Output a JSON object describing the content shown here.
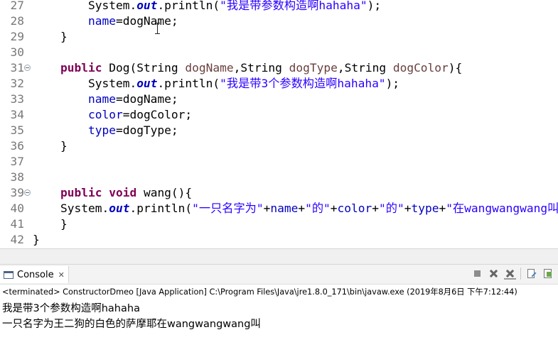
{
  "editor": {
    "lines": [
      {
        "num": "27",
        "fold": false,
        "tokens": [
          {
            "t": "        System.",
            "c": ""
          },
          {
            "t": "out",
            "c": "static"
          },
          {
            "t": ".println(",
            "c": ""
          },
          {
            "t": "\"我是带参数构造啊hahaha\"",
            "c": "str"
          },
          {
            "t": ");",
            "c": ""
          }
        ]
      },
      {
        "num": "28",
        "fold": false,
        "tokens": [
          {
            "t": "        ",
            "c": ""
          },
          {
            "t": "name",
            "c": "field"
          },
          {
            "t": "=dogName;",
            "c": ""
          }
        ]
      },
      {
        "num": "29",
        "fold": false,
        "tokens": [
          {
            "t": "    }",
            "c": ""
          }
        ]
      },
      {
        "num": "30",
        "fold": false,
        "tokens": []
      },
      {
        "num": "31",
        "fold": true,
        "tokens": [
          {
            "t": "    ",
            "c": ""
          },
          {
            "t": "public",
            "c": "kw"
          },
          {
            "t": " Dog(String ",
            "c": ""
          },
          {
            "t": "dogName",
            "c": "param"
          },
          {
            "t": ",String ",
            "c": ""
          },
          {
            "t": "dogType",
            "c": "param"
          },
          {
            "t": ",String ",
            "c": ""
          },
          {
            "t": "dogColor",
            "c": "param"
          },
          {
            "t": "){",
            "c": ""
          }
        ]
      },
      {
        "num": "32",
        "fold": false,
        "tokens": [
          {
            "t": "        System.",
            "c": ""
          },
          {
            "t": "out",
            "c": "static"
          },
          {
            "t": ".println(",
            "c": ""
          },
          {
            "t": "\"我是带3个参数构造啊hahaha\"",
            "c": "str"
          },
          {
            "t": ");",
            "c": ""
          }
        ]
      },
      {
        "num": "33",
        "fold": false,
        "tokens": [
          {
            "t": "        ",
            "c": ""
          },
          {
            "t": "name",
            "c": "field"
          },
          {
            "t": "=dogName;",
            "c": ""
          }
        ]
      },
      {
        "num": "34",
        "fold": false,
        "tokens": [
          {
            "t": "        ",
            "c": ""
          },
          {
            "t": "color",
            "c": "field"
          },
          {
            "t": "=dogColor;",
            "c": ""
          }
        ]
      },
      {
        "num": "35",
        "fold": false,
        "tokens": [
          {
            "t": "        ",
            "c": ""
          },
          {
            "t": "type",
            "c": "field"
          },
          {
            "t": "=dogType;",
            "c": ""
          }
        ]
      },
      {
        "num": "36",
        "fold": false,
        "tokens": [
          {
            "t": "    }",
            "c": ""
          }
        ]
      },
      {
        "num": "37",
        "fold": false,
        "tokens": []
      },
      {
        "num": "38",
        "fold": false,
        "tokens": []
      },
      {
        "num": "39",
        "fold": true,
        "tokens": [
          {
            "t": "    ",
            "c": ""
          },
          {
            "t": "public",
            "c": "kw"
          },
          {
            "t": " ",
            "c": ""
          },
          {
            "t": "void",
            "c": "kw"
          },
          {
            "t": " wang(){",
            "c": ""
          }
        ]
      },
      {
        "num": "40",
        "fold": false,
        "tokens": [
          {
            "t": "    System.",
            "c": ""
          },
          {
            "t": "out",
            "c": "static"
          },
          {
            "t": ".println(",
            "c": ""
          },
          {
            "t": "\"一只名字为\"",
            "c": "str"
          },
          {
            "t": "+",
            "c": ""
          },
          {
            "t": "name",
            "c": "field"
          },
          {
            "t": "+",
            "c": ""
          },
          {
            "t": "\"的\"",
            "c": "str"
          },
          {
            "t": "+",
            "c": ""
          },
          {
            "t": "color",
            "c": "field"
          },
          {
            "t": "+",
            "c": ""
          },
          {
            "t": "\"的\"",
            "c": "str"
          },
          {
            "t": "+",
            "c": ""
          },
          {
            "t": "type",
            "c": "field"
          },
          {
            "t": "+",
            "c": ""
          },
          {
            "t": "\"在wangwangwang叫",
            "c": "str"
          }
        ]
      },
      {
        "num": "41",
        "fold": false,
        "tokens": [
          {
            "t": "    }",
            "c": ""
          }
        ]
      },
      {
        "num": "42",
        "fold": false,
        "tokens": [
          {
            "t": "}",
            "c": ""
          }
        ]
      }
    ]
  },
  "console": {
    "tab_label": "Console",
    "tab_close": "✕",
    "launch_info": "<terminated> ConstructorDmeo [Java Application] C:\\Program Files\\Java\\jre1.8.0_171\\bin\\javaw.exe (2019年8月6日 下午7:12:44)",
    "output": [
      "我是带3个参数构造啊hahaha",
      "一只名字为王二狗的白色的萨摩耶在wangwangwang叫"
    ],
    "toolbar_icons": [
      "terminate-icon",
      "remove-launch-icon",
      "remove-all-terminated-icon",
      "clear-console-icon",
      "pin-console-icon"
    ]
  }
}
